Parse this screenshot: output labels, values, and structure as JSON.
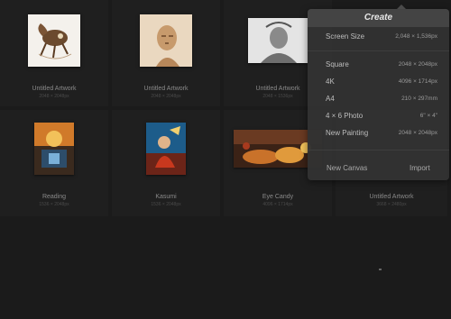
{
  "artworks": [
    {
      "title": "Untitled Artwork",
      "dims": "2048 × 2048px"
    },
    {
      "title": "Untitled Artwork",
      "dims": "2048 × 2048px"
    },
    {
      "title": "Untitled Artwork",
      "dims": "2048 × 1536px"
    },
    {
      "title": "Reading",
      "dims": "1536 × 2048px"
    },
    {
      "title": "Kasumi",
      "dims": "1536 × 2048px"
    },
    {
      "title": "Eye Candy",
      "dims": "4096 × 1714px"
    },
    {
      "title": "Untitled Artwork",
      "dims": "3668 × 2480px"
    }
  ],
  "create_menu": {
    "title": "Create",
    "screen_size": {
      "label": "Screen Size",
      "value": "2,048 × 1,536px"
    },
    "presets": [
      {
        "label": "Square",
        "value": "2048 × 2048px"
      },
      {
        "label": "4K",
        "value": "4096 × 1714px"
      },
      {
        "label": "A4",
        "value": "210 × 297mm"
      },
      {
        "label": "4 × 6 Photo",
        "value": "6\" × 4\""
      },
      {
        "label": "New Painting",
        "value": "2048 × 2048px"
      }
    ],
    "new_canvas": "New Canvas",
    "import": "Import"
  },
  "colors": {
    "background": "#1b1b1b",
    "popover": "#323232",
    "popover_header": "#444444"
  }
}
